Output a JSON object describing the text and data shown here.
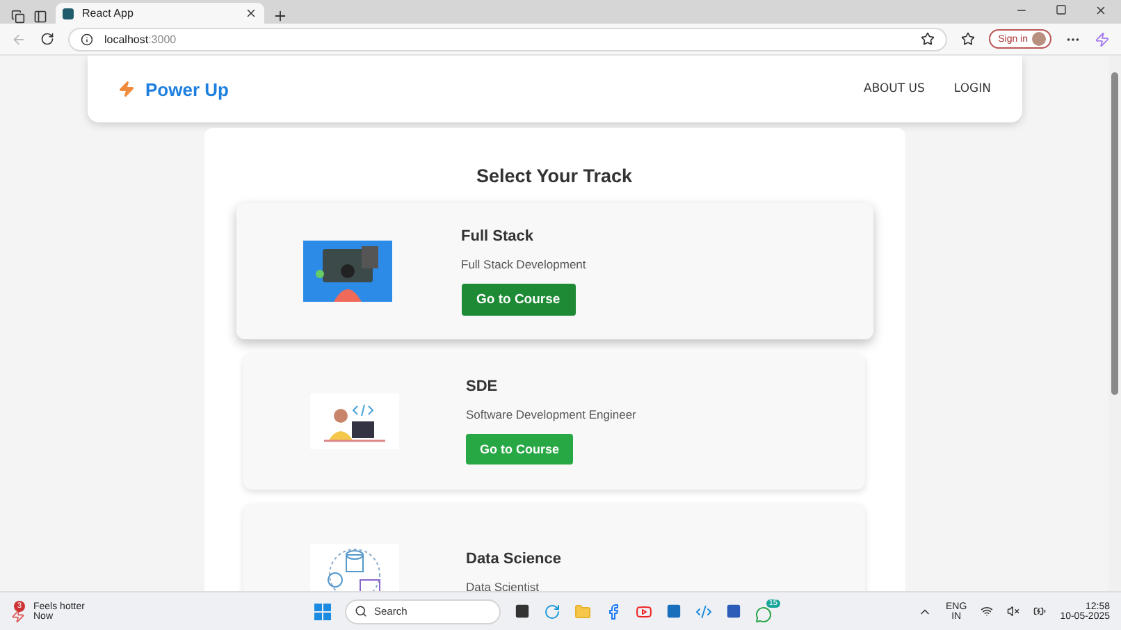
{
  "browser": {
    "tab_title": "React App",
    "url_host": "localhost",
    "url_port": ":3000",
    "sign_in": "Sign in"
  },
  "navbar": {
    "brand": "Power Up",
    "links": [
      "ABOUT US",
      "LOGIN"
    ]
  },
  "page_title": "Select Your Track",
  "tracks": [
    {
      "kind": "fullstack",
      "title": "Full Stack",
      "subtitle": "Full Stack Development",
      "button": "Go to Course",
      "hovered": true
    },
    {
      "kind": "sde",
      "title": "SDE",
      "subtitle": "Software Development Engineer",
      "button": "Go to Course",
      "hovered": false
    },
    {
      "kind": "datascience",
      "title": "Data Science",
      "subtitle": "Data Scientist",
      "hovered": false
    }
  ],
  "taskbar": {
    "weather_title": "Feels hotter",
    "weather_sub": "Now",
    "weather_badge": "3",
    "search_placeholder": "Search",
    "whatsapp_badge": "15",
    "lang": "ENG",
    "region": "IN",
    "time": "12:58",
    "date": "10-05-2025"
  }
}
